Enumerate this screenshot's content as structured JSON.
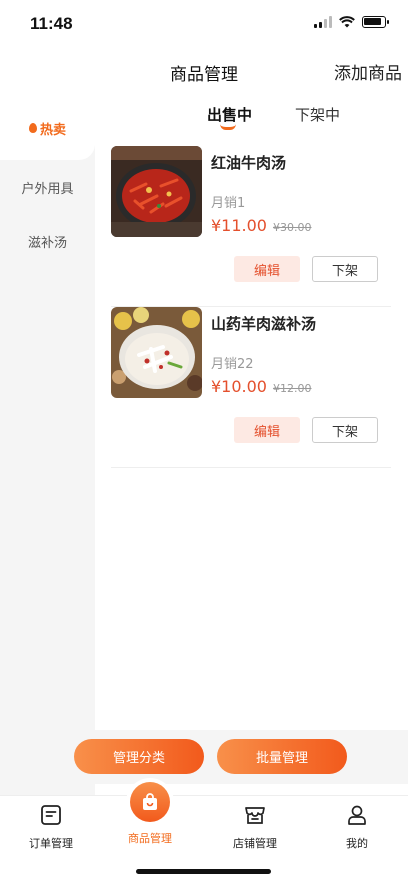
{
  "status_bar": {
    "time": "11:48"
  },
  "header": {
    "title": "商品管理",
    "add_label": "添加商品"
  },
  "sidebar": {
    "items": [
      {
        "label": "热卖",
        "active": true
      },
      {
        "label": "户外用具",
        "active": false
      },
      {
        "label": "滋补汤",
        "active": false
      }
    ]
  },
  "tabs": [
    {
      "label": "出售中",
      "active": true
    },
    {
      "label": "下架中",
      "active": false
    }
  ],
  "products": [
    {
      "name": "红油牛肉汤",
      "sales": "月销1",
      "price": "¥11.00",
      "original_price": "¥30.00",
      "edit_label": "编辑",
      "offshelf_label": "下架"
    },
    {
      "name": "山药羊肉滋补汤",
      "sales": "月销22",
      "price": "¥10.00",
      "original_price": "¥12.00",
      "edit_label": "编辑",
      "offshelf_label": "下架"
    }
  ],
  "actions": {
    "manage_category": "管理分类",
    "batch_manage": "批量管理"
  },
  "tabbar": {
    "items": [
      {
        "label": "订单管理",
        "icon": "order-icon"
      },
      {
        "label": "商品管理",
        "icon": "shopping-bag-icon",
        "active": true
      },
      {
        "label": "店铺管理",
        "icon": "store-icon"
      },
      {
        "label": "我的",
        "icon": "user-icon"
      }
    ]
  },
  "colors": {
    "accent": "#f26b1d",
    "price": "#e4502d"
  }
}
